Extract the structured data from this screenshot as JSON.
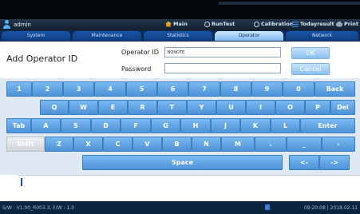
{
  "header": {
    "user": "admin",
    "nav": [
      {
        "label": "Main",
        "icon": "home-icon"
      },
      {
        "label": "RunTest",
        "icon": "runtest-icon"
      },
      {
        "label": "Calibration",
        "icon": "calibration-icon"
      },
      {
        "label": "Todayresult",
        "icon": "list-icon"
      },
      {
        "label": "Print",
        "icon": "print-icon"
      }
    ]
  },
  "tabs": [
    "System",
    "Maintenance",
    "Statistics",
    "Operator",
    "Network"
  ],
  "active_tab": "Operator",
  "form": {
    "title": "Add Operator ID",
    "operator_id_label": "Operator ID",
    "operator_id_value": "BONOTE",
    "password_label": "Password",
    "password_value": "",
    "ok_label": "OK",
    "cancel_label": "Cancel"
  },
  "keyboard": {
    "row1": [
      "1",
      "2",
      "3",
      "4",
      "5",
      "6",
      "7",
      "8",
      "9",
      "0",
      "Back"
    ],
    "row2": [
      "Q",
      "W",
      "E",
      "R",
      "T",
      "Y",
      "U",
      "I",
      "O",
      "P",
      "Del"
    ],
    "row3": [
      "Tab",
      "A",
      "S",
      "D",
      "F",
      "G",
      "H",
      "J",
      "K",
      "L",
      "Enter"
    ],
    "row4": [
      "Shift",
      "Z",
      "X",
      "C",
      "V",
      "B",
      "N",
      "M",
      ".",
      "_",
      "-"
    ],
    "row5": [
      "Space",
      "<-",
      "->"
    ]
  },
  "status": {
    "version": "S/W : V1.00_R003.3, F/W : 1.0",
    "datetime": "09:20:08 | 2018.02.11"
  },
  "colors": {
    "key": "#5fa3e3",
    "active_tab": "#a9d2f5",
    "background": "#1b2a3a"
  }
}
